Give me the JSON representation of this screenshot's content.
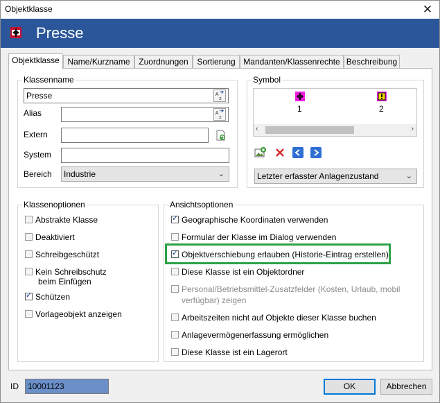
{
  "window": {
    "title": "Objektklasse",
    "close_glyph": "✕"
  },
  "banner": {
    "title": "Presse",
    "icon": "class-icon"
  },
  "tabs": [
    {
      "label": "Objektklasse",
      "active": true
    },
    {
      "label": "Name/Kurzname"
    },
    {
      "label": "Zuordnungen"
    },
    {
      "label": "Sortierung"
    },
    {
      "label": "Mandanten/Klassenrechte"
    },
    {
      "label": "Beschreibung"
    }
  ],
  "klassenname": {
    "legend": "Klassenname",
    "name_value": "Presse",
    "alias_label": "Alias",
    "alias_value": "",
    "extern_label": "Extern",
    "extern_value": "",
    "system_label": "System",
    "system_value": "",
    "bereich_label": "Bereich",
    "bereich_value": "Industrie"
  },
  "symbol": {
    "legend": "Symbol",
    "items": [
      {
        "number": "1"
      },
      {
        "number": "2"
      }
    ],
    "state_select": "Letzter erfasster Anlagenzustand"
  },
  "klassenoptionen": {
    "legend": "Klassenoptionen",
    "items": [
      {
        "label": "Abstrakte Klasse",
        "checked": false
      },
      {
        "label": "Deaktiviert",
        "checked": false
      },
      {
        "label": "Schreibgeschützt",
        "checked": false
      },
      {
        "label": "Kein Schreibschutz",
        "label2": "beim Einfügen",
        "checked": false
      },
      {
        "label": "Schützen",
        "checked": true
      },
      {
        "label": "Vorlageobjekt anzeigen",
        "checked": false
      }
    ]
  },
  "ansichtsoptionen": {
    "legend": "Ansichtsoptionen",
    "items": [
      {
        "label": "Geographische Koordinaten verwenden",
        "checked": true
      },
      {
        "label": "Formular der Klasse im Dialog verwenden",
        "checked": false
      },
      {
        "label": "Objektverschiebung erlauben (Historie-Eintrag erstellen)",
        "checked": true
      },
      {
        "label": "Diese Klasse ist ein Objektordner",
        "checked": false
      },
      {
        "label": "Personal/Betriebsmittel-Zusatzfelder (Kosten, Urlaub, mobil",
        "label2": "verfügbar) zeigen",
        "checked": false,
        "disabled": true
      },
      {
        "label": "Arbeitszeiten nicht auf Objekte dieser Klasse buchen",
        "checked": false
      },
      {
        "label": "Anlagevermögenerfassung ermöglichen",
        "checked": false
      },
      {
        "label": "Diese Klasse ist ein Lagerort",
        "checked": false
      }
    ]
  },
  "footer": {
    "id_label": "ID",
    "id_value": "10001123",
    "ok_label": "OK",
    "cancel_label": "Abbrechen"
  },
  "colors": {
    "banner": "#2b579a",
    "highlight": "#2da147",
    "select_bg": "#e5e5e5",
    "id_bg": "#6a8fc9"
  }
}
